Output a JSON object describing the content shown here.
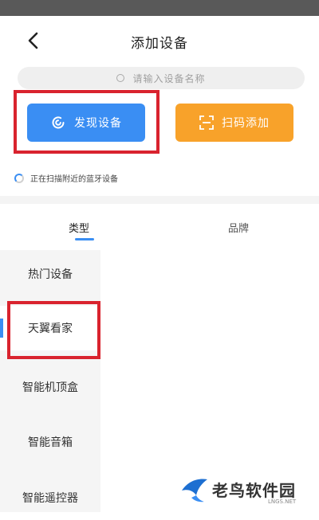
{
  "header": {
    "title": "添加设备"
  },
  "search": {
    "placeholder": "请输入设备名称"
  },
  "actions": {
    "discover_label": "发现设备",
    "scan_label": "扫码添加"
  },
  "scan_status": "正在扫描附近的蓝牙设备",
  "tabs": [
    {
      "label": "类型",
      "active": true
    },
    {
      "label": "品牌",
      "active": false
    }
  ],
  "categories": [
    {
      "label": "热门设备"
    },
    {
      "label": "天翼看家",
      "active": true
    },
    {
      "label": "智能机顶盒"
    },
    {
      "label": "智能音箱"
    },
    {
      "label": "智能遥控器"
    }
  ],
  "watermark": {
    "name": "老鸟软件园",
    "site": "LNGS.NET"
  },
  "colors": {
    "accent_blue": "#3a8ef3",
    "accent_orange": "#f8a22a",
    "highlight_red": "#d9232e",
    "status_bar": "#595959"
  },
  "icons": {
    "back": "chevron-left-icon",
    "search": "search-icon",
    "discover": "discover-icon",
    "scan": "qr-scan-icon",
    "loading": "spinner-icon"
  }
}
